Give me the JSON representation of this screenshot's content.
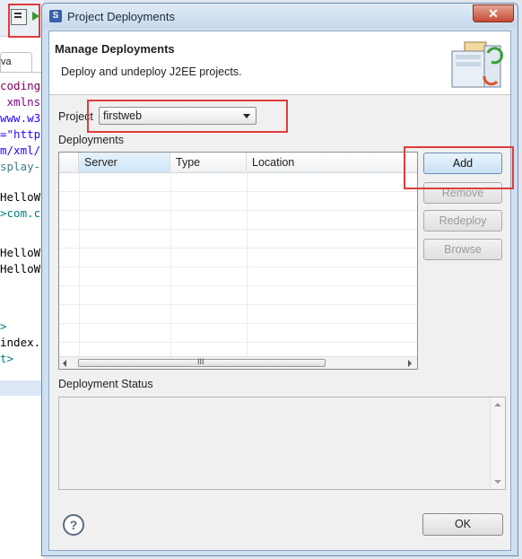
{
  "ide": {
    "tab_label": "va",
    "code_lines": [
      {
        "text": "coding",
        "color": "#7f0055"
      },
      {
        "text": " xmlns",
        "color": "#7f007f"
      },
      {
        "text": "www.w3",
        "color": "#2a00ff"
      },
      {
        "text": "=\"http",
        "color": "#2a00ff"
      },
      {
        "text": "m/xml/",
        "color": "#2a00ff"
      },
      {
        "text": "splay-",
        "color": "#3f7f7f"
      },
      {
        "text": "HelloW",
        "color": "#000000"
      },
      {
        "text": ">com.c",
        "color": "#008080"
      },
      {
        "text": "HelloW",
        "color": "#000000"
      },
      {
        "text": "HelloW",
        "color": "#000000"
      },
      {
        "text": ">",
        "color": "#008080"
      },
      {
        "text": "index.",
        "color": "#000000"
      },
      {
        "text": "t>",
        "color": "#008080"
      }
    ]
  },
  "dialog": {
    "title": "Project Deployments",
    "close_symbol": "✕",
    "header_title": "Manage Deployments",
    "header_description": "Deploy and undeploy J2EE projects.",
    "project_label": "Project",
    "project_value": "firstweb",
    "deployments_label": "Deployments",
    "columns": [
      "Server",
      "Type",
      "Location"
    ],
    "scroll_grip": "III",
    "buttons": {
      "add": "Add",
      "remove": "Remove",
      "redeploy": "Redeploy",
      "browse": "Browse",
      "ok": "OK"
    },
    "status_label": "Deployment Status",
    "help_symbol": "?"
  }
}
